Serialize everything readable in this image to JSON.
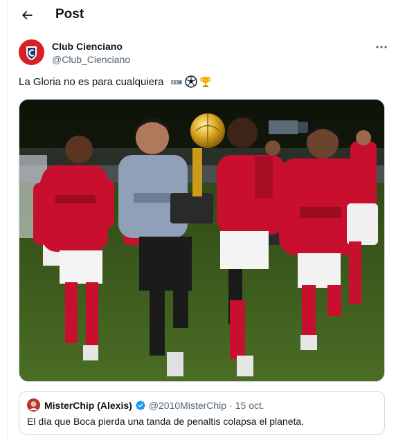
{
  "header": {
    "title": "Post"
  },
  "post": {
    "display_name": "Club Cienciano",
    "handle": "@Club_Cienciano",
    "text": "La Gloria no es para cualquiera",
    "emojis": [
      "film-strip-emoji",
      "soccer-ball-emoji",
      "trophy-emoji"
    ],
    "media": {
      "description": "photo",
      "colors": {
        "jersey": "#c8102e",
        "grass": "#3d5a1e"
      }
    }
  },
  "quote": {
    "display_name": "MisterChip (Alexis)",
    "verified": true,
    "handle": "@2010MisterChip",
    "separator": "·",
    "date": "15 oct.",
    "text": "El día que Boca pierda una tanda de penaltis colapsa el planeta."
  },
  "colors": {
    "text": "#0f1419",
    "secondary": "#536471",
    "border": "#cfd9de",
    "verified": "#1d9bf0",
    "brand": "#d81f26"
  }
}
